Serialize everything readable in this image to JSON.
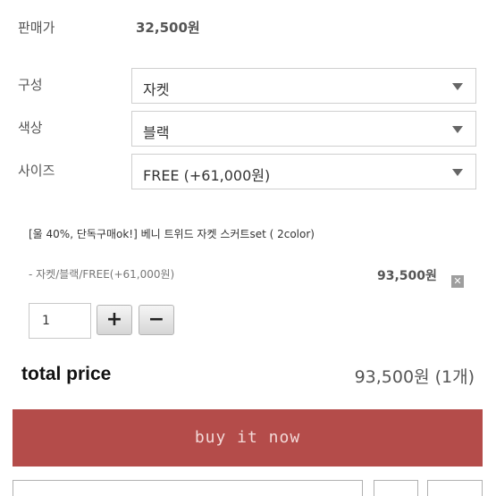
{
  "sale_price": {
    "label": "판매가",
    "value": "32,500원"
  },
  "options": [
    {
      "label": "구성",
      "selected": "자켓"
    },
    {
      "label": "색상",
      "selected": "블랙"
    },
    {
      "label": "사이즈",
      "selected": "FREE (+61,000원)"
    }
  ],
  "selected_item": {
    "title": "[울 40%, 단독구매ok!] 베니 트위드 자켓 스커트set ( 2color)",
    "option_text": "- 자켓/블랙/FREE(+61,000원)",
    "price": "93,500원",
    "delete_icon": "close-icon",
    "quantity": "1",
    "plus_label": "+",
    "minus_label": "−"
  },
  "total": {
    "label": "total price",
    "value": "93,500원 (1개)"
  },
  "buy_button": {
    "label": "buy it now",
    "color": "#b44c4a"
  }
}
